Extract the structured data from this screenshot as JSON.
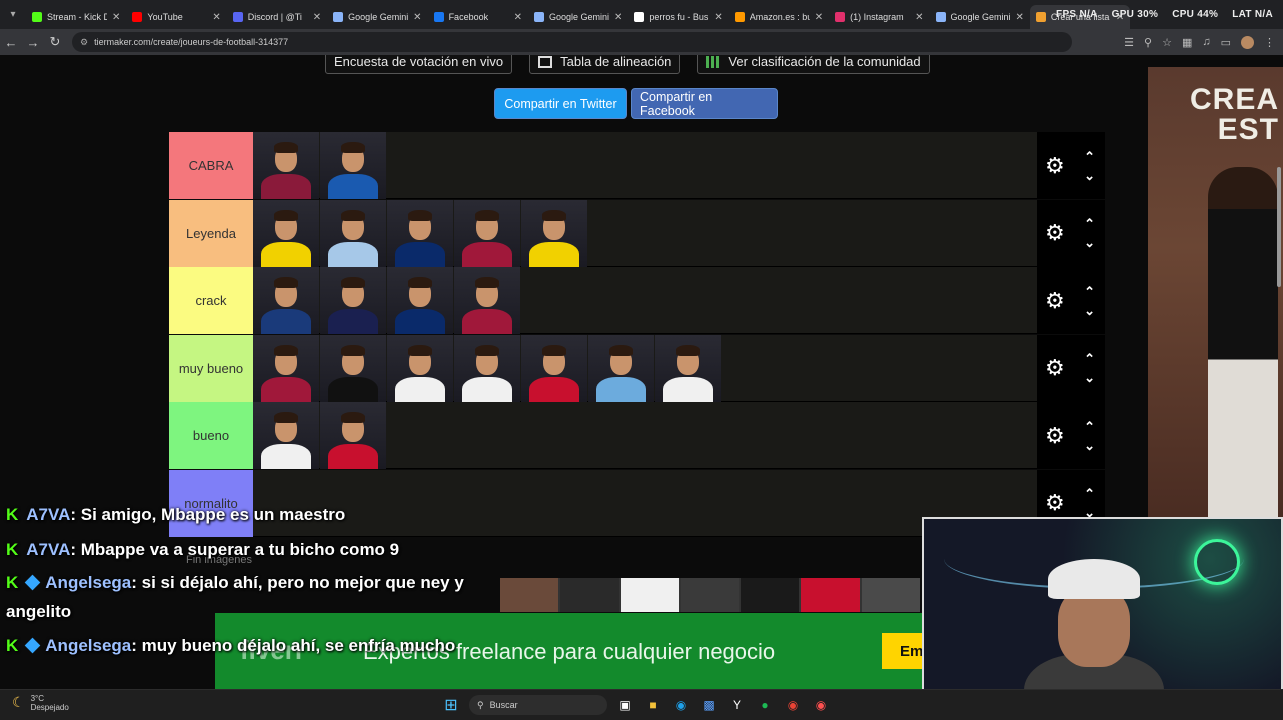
{
  "browser": {
    "tabs": [
      {
        "label": "Stream - Kick D",
        "color": "#53fc18"
      },
      {
        "label": "YouTube",
        "color": "#ff0000"
      },
      {
        "label": "Discord | @Ti",
        "color": "#5865f2"
      },
      {
        "label": "Google Gemini",
        "color": "#8ab4f8"
      },
      {
        "label": "Facebook",
        "color": "#1877f2"
      },
      {
        "label": "Google Gemini",
        "color": "#8ab4f8"
      },
      {
        "label": "perros fu - Bus",
        "color": "#ffffff"
      },
      {
        "label": "Amazon.es : bu",
        "color": "#ff9900"
      },
      {
        "label": "(1) Instagram",
        "color": "#e1306c"
      },
      {
        "label": "Google Gemini",
        "color": "#8ab4f8"
      },
      {
        "label": "Crear una lista",
        "color": "#f0a030"
      }
    ],
    "stats": {
      "fps": "FPS N/A",
      "gpu": "GPU 30%",
      "cpu": "CPU 44%",
      "lat": "LAT N/A"
    },
    "url": "tiermaker.com/create/joueurs-de-football-314377"
  },
  "page": {
    "top_buttons": {
      "poll": "Encuesta de votación en vivo",
      "lineup": "Tabla de alineación",
      "community": "Ver clasificación de la comunidad"
    },
    "share_twitter": "Compartir en Twitter",
    "share_facebook": "Compartir en Facebook",
    "tiers": [
      {
        "label": "CABRA",
        "color": "#f4777c",
        "players": [
          "#8a1a3a",
          "#1a5ab0"
        ]
      },
      {
        "label": "Leyenda",
        "color": "#f8be7f",
        "players": [
          "#f1d100",
          "#a6c8e8",
          "#0a2a6a",
          "#a0183a",
          "#f1d100"
        ]
      },
      {
        "label": "crack",
        "color": "#fbfb81",
        "players": [
          "#1a3a7a",
          "#1a2050",
          "#0a2a6a",
          "#a0183a"
        ]
      },
      {
        "label": "muy bueno",
        "color": "#c5f682",
        "players": [
          "#a0183a",
          "#111111",
          "#f0f0f0",
          "#f0f0f0",
          "#c8102e",
          "#6cabdd",
          "#f0f0f0"
        ]
      },
      {
        "label": "bueno",
        "color": "#7ef57f",
        "players": [
          "#f0f0f0",
          "#c8102e"
        ]
      },
      {
        "label": "normalito",
        "color": "#7f7ff7",
        "players": []
      }
    ],
    "side_ad_text": "CREA\nEST"
  },
  "chat": {
    "messages": [
      {
        "user": "A7VA",
        "text": ": Si amigo, Mbappe es un maestro",
        "badge": false
      },
      {
        "user": "A7VA",
        "text": ": Mbappe va a superar a tu bicho como 9",
        "badge": false
      },
      {
        "user": "Angelsega",
        "text": ": si si déjalo ahí, pero no mejor que ney y",
        "badge": true
      },
      {
        "user": "",
        "text": "angelito",
        "badge": false
      },
      {
        "user": "Angelsega",
        "text": ": muy bueno déjalo ahí, se enfría mucho",
        "badge": true
      }
    ],
    "pinned_label": "Fin imágenes",
    "ad_text": "Expertos freelance para cualquier negocio",
    "ad_button": "Em"
  },
  "taskbar": {
    "temp": "3°C",
    "weather": "Despejado",
    "search_placeholder": "Buscar"
  }
}
